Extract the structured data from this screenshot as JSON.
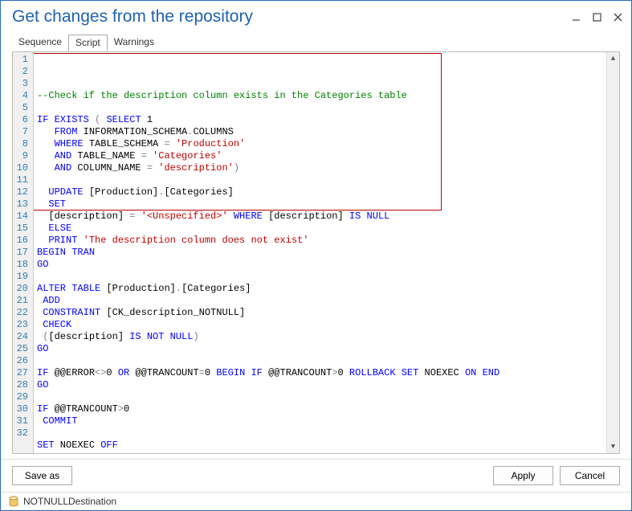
{
  "window": {
    "title": "Get changes from the repository"
  },
  "tabs": {
    "sequence": "Sequence",
    "script": "Script",
    "warnings": "Warnings"
  },
  "code": {
    "lines": [
      {
        "n": 1,
        "t": "com",
        "txt": "--Check if the description column exists in the Categories table"
      },
      {
        "n": 2,
        "t": "",
        "txt": ""
      },
      {
        "n": 3,
        "t": "mix",
        "parts": [
          {
            "c": "kw",
            "s": "IF"
          },
          {
            "c": "",
            "s": " "
          },
          {
            "c": "kw",
            "s": "EXISTS"
          },
          {
            "c": "",
            "s": " "
          },
          {
            "c": "op",
            "s": "("
          },
          {
            "c": "",
            "s": " "
          },
          {
            "c": "kw",
            "s": "SELECT"
          },
          {
            "c": "",
            "s": " 1"
          }
        ]
      },
      {
        "n": 4,
        "t": "mix",
        "parts": [
          {
            "c": "",
            "s": "   "
          },
          {
            "c": "kw",
            "s": "FROM"
          },
          {
            "c": "",
            "s": " INFORMATION_SCHEMA"
          },
          {
            "c": "op",
            "s": "."
          },
          {
            "c": "",
            "s": "COLUMNS"
          }
        ]
      },
      {
        "n": 5,
        "t": "mix",
        "parts": [
          {
            "c": "",
            "s": "   "
          },
          {
            "c": "kw",
            "s": "WHERE"
          },
          {
            "c": "",
            "s": " TABLE_SCHEMA "
          },
          {
            "c": "op",
            "s": "="
          },
          {
            "c": "",
            "s": " "
          },
          {
            "c": "str",
            "s": "'Production'"
          }
        ]
      },
      {
        "n": 6,
        "t": "mix",
        "parts": [
          {
            "c": "",
            "s": "   "
          },
          {
            "c": "kw",
            "s": "AND"
          },
          {
            "c": "",
            "s": " TABLE_NAME "
          },
          {
            "c": "op",
            "s": "="
          },
          {
            "c": "",
            "s": " "
          },
          {
            "c": "str",
            "s": "'Categories'"
          }
        ]
      },
      {
        "n": 7,
        "t": "mix",
        "parts": [
          {
            "c": "",
            "s": "   "
          },
          {
            "c": "kw",
            "s": "AND"
          },
          {
            "c": "",
            "s": " COLUMN_NAME "
          },
          {
            "c": "op",
            "s": "="
          },
          {
            "c": "",
            "s": " "
          },
          {
            "c": "str",
            "s": "'description'"
          },
          {
            "c": "op",
            "s": ")"
          }
        ]
      },
      {
        "n": 8,
        "t": "",
        "txt": ""
      },
      {
        "n": 9,
        "t": "mix",
        "parts": [
          {
            "c": "",
            "s": "  "
          },
          {
            "c": "kw",
            "s": "UPDATE"
          },
          {
            "c": "",
            "s": " [Production]"
          },
          {
            "c": "op",
            "s": "."
          },
          {
            "c": "",
            "s": "[Categories]"
          }
        ]
      },
      {
        "n": 10,
        "t": "mix",
        "parts": [
          {
            "c": "",
            "s": "  "
          },
          {
            "c": "kw",
            "s": "SET"
          }
        ]
      },
      {
        "n": 11,
        "t": "mix",
        "parts": [
          {
            "c": "",
            "s": "  [description] "
          },
          {
            "c": "op",
            "s": "="
          },
          {
            "c": "",
            "s": " "
          },
          {
            "c": "str",
            "s": "'<Unspecified>'"
          },
          {
            "c": "",
            "s": " "
          },
          {
            "c": "kw",
            "s": "WHERE"
          },
          {
            "c": "",
            "s": " [description] "
          },
          {
            "c": "kw",
            "s": "IS"
          },
          {
            "c": "",
            "s": " "
          },
          {
            "c": "kw",
            "s": "NULL"
          }
        ]
      },
      {
        "n": 12,
        "t": "mix",
        "parts": [
          {
            "c": "",
            "s": "  "
          },
          {
            "c": "kw",
            "s": "ELSE"
          }
        ]
      },
      {
        "n": 13,
        "t": "mix",
        "parts": [
          {
            "c": "",
            "s": "  "
          },
          {
            "c": "kw",
            "s": "PRINT"
          },
          {
            "c": "",
            "s": " "
          },
          {
            "c": "str",
            "s": "'The description column does not exist'"
          }
        ]
      },
      {
        "n": 14,
        "t": "mix",
        "parts": [
          {
            "c": "kw",
            "s": "BEGIN"
          },
          {
            "c": "",
            "s": " "
          },
          {
            "c": "kw",
            "s": "TRAN"
          }
        ]
      },
      {
        "n": 15,
        "t": "kw",
        "txt": "GO"
      },
      {
        "n": 16,
        "t": "",
        "txt": ""
      },
      {
        "n": 17,
        "t": "mix",
        "parts": [
          {
            "c": "kw",
            "s": "ALTER"
          },
          {
            "c": "",
            "s": " "
          },
          {
            "c": "kw",
            "s": "TABLE"
          },
          {
            "c": "",
            "s": " [Production]"
          },
          {
            "c": "op",
            "s": "."
          },
          {
            "c": "",
            "s": "[Categories]"
          }
        ]
      },
      {
        "n": 18,
        "t": "mix",
        "parts": [
          {
            "c": "",
            "s": " "
          },
          {
            "c": "kw",
            "s": "ADD"
          }
        ]
      },
      {
        "n": 19,
        "t": "mix",
        "parts": [
          {
            "c": "",
            "s": " "
          },
          {
            "c": "kw",
            "s": "CONSTRAINT"
          },
          {
            "c": "",
            "s": " [CK_description_NOTNULL]"
          }
        ]
      },
      {
        "n": 20,
        "t": "mix",
        "parts": [
          {
            "c": "",
            "s": " "
          },
          {
            "c": "kw",
            "s": "CHECK"
          }
        ]
      },
      {
        "n": 21,
        "t": "mix",
        "parts": [
          {
            "c": "",
            "s": " "
          },
          {
            "c": "op",
            "s": "("
          },
          {
            "c": "",
            "s": "[description] "
          },
          {
            "c": "kw",
            "s": "IS"
          },
          {
            "c": "",
            "s": " "
          },
          {
            "c": "kw",
            "s": "NOT"
          },
          {
            "c": "",
            "s": " "
          },
          {
            "c": "kw",
            "s": "NULL"
          },
          {
            "c": "op",
            "s": ")"
          }
        ]
      },
      {
        "n": 22,
        "t": "kw",
        "txt": "GO"
      },
      {
        "n": 23,
        "t": "",
        "txt": ""
      },
      {
        "n": 24,
        "t": "mix",
        "parts": [
          {
            "c": "kw",
            "s": "IF"
          },
          {
            "c": "",
            "s": " @@ERROR"
          },
          {
            "c": "op",
            "s": "<>"
          },
          {
            "c": "",
            "s": "0 "
          },
          {
            "c": "kw",
            "s": "OR"
          },
          {
            "c": "",
            "s": " @@TRANCOUNT"
          },
          {
            "c": "op",
            "s": "="
          },
          {
            "c": "",
            "s": "0 "
          },
          {
            "c": "kw",
            "s": "BEGIN"
          },
          {
            "c": "",
            "s": " "
          },
          {
            "c": "kw",
            "s": "IF"
          },
          {
            "c": "",
            "s": " @@TRANCOUNT"
          },
          {
            "c": "op",
            "s": ">"
          },
          {
            "c": "",
            "s": "0 "
          },
          {
            "c": "kw",
            "s": "ROLLBACK"
          },
          {
            "c": "",
            "s": " "
          },
          {
            "c": "kw",
            "s": "SET"
          },
          {
            "c": "",
            "s": " NOEXEC "
          },
          {
            "c": "kw",
            "s": "ON"
          },
          {
            "c": "",
            "s": " "
          },
          {
            "c": "kw",
            "s": "END"
          }
        ]
      },
      {
        "n": 25,
        "t": "kw",
        "txt": "GO"
      },
      {
        "n": 26,
        "t": "",
        "txt": ""
      },
      {
        "n": 27,
        "t": "mix",
        "parts": [
          {
            "c": "kw",
            "s": "IF"
          },
          {
            "c": "",
            "s": " @@TRANCOUNT"
          },
          {
            "c": "op",
            "s": ">"
          },
          {
            "c": "",
            "s": "0"
          }
        ]
      },
      {
        "n": 28,
        "t": "mix",
        "parts": [
          {
            "c": "",
            "s": " "
          },
          {
            "c": "kw",
            "s": "COMMIT"
          }
        ]
      },
      {
        "n": 29,
        "t": "",
        "txt": ""
      },
      {
        "n": 30,
        "t": "mix",
        "parts": [
          {
            "c": "kw",
            "s": "SET"
          },
          {
            "c": "",
            "s": " NOEXEC "
          },
          {
            "c": "kw",
            "s": "OFF"
          }
        ]
      },
      {
        "n": 31,
        "t": "kw",
        "txt": "GO"
      },
      {
        "n": 32,
        "t": "",
        "txt": ""
      }
    ]
  },
  "buttons": {
    "save_as": "Save as",
    "apply": "Apply",
    "cancel": "Cancel"
  },
  "status": {
    "db": "NOTNULLDestination"
  }
}
